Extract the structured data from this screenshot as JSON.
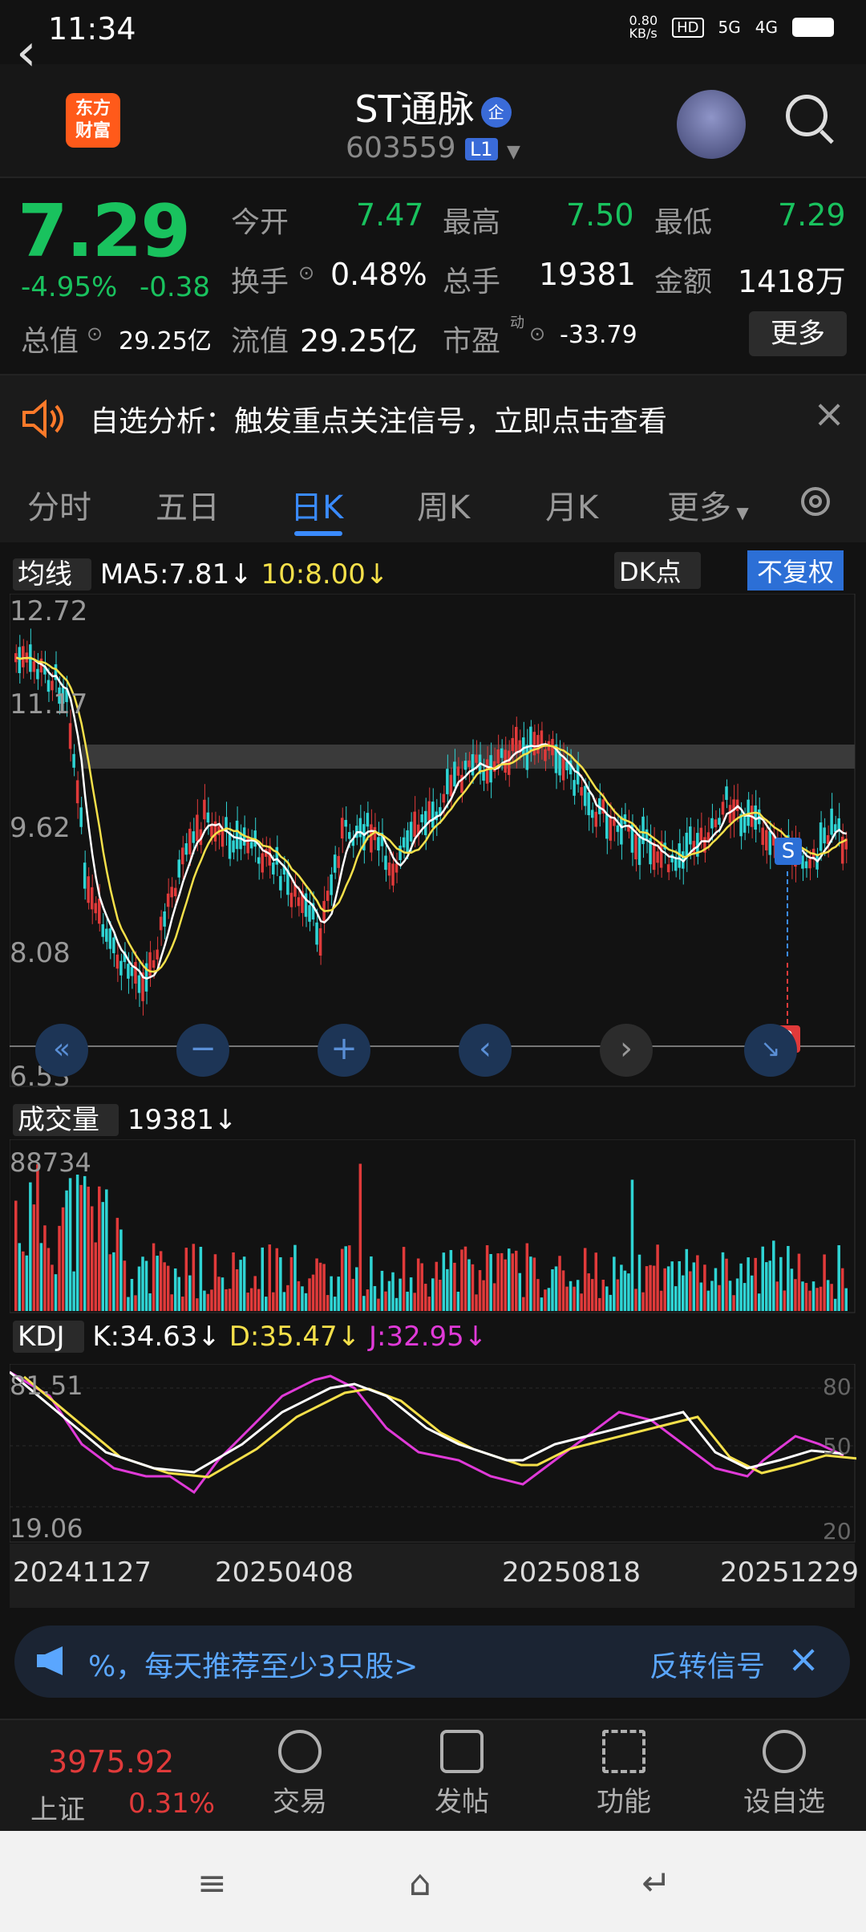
{
  "status": {
    "time": "11:34",
    "speed": "0.80\nKB/s",
    "net1": "5G",
    "net2": "4G"
  },
  "header": {
    "logo": "东方\n财富",
    "title": "ST通脉",
    "title_tag": "企",
    "code": "603559",
    "level": "L1"
  },
  "quote": {
    "price": "7.29",
    "pct": "-4.95%",
    "change": "-0.38",
    "open_label": "今开",
    "open": "7.47",
    "high_label": "最高",
    "high": "7.50",
    "low_label": "最低",
    "low": "7.29",
    "turnover_label": "换手",
    "turnover": "0.48%",
    "volume_label": "总手",
    "volume": "19381",
    "amount_label": "金额",
    "amount": "1418万",
    "mcap_label": "总值",
    "mcap": "29.25亿",
    "float_label": "流值",
    "float": "29.25亿",
    "pe_label": "市盈",
    "pe_sup": "动",
    "pe": "-33.79",
    "more": "更多"
  },
  "notice": {
    "text": "自选分析：触发重点关注信号，立即点击查看"
  },
  "tabs": [
    "分时",
    "五日",
    "日K",
    "周K",
    "月K",
    "更多"
  ],
  "kline": {
    "indicator": "均线",
    "ma5": "MA5:7.81↓",
    "ma10": "10:8.00↓",
    "dk": "DK点",
    "fq": "不复权",
    "levels": [
      "12.72",
      "11.17",
      "9.62",
      "8.08",
      "6.53"
    ],
    "signal_s": "S",
    "signal_b": "B"
  },
  "volume": {
    "indicator": "成交量",
    "value": "19381↓",
    "max": "88734"
  },
  "kdj": {
    "indicator": "KDJ",
    "k": "K:34.63↓",
    "d": "D:35.47↓",
    "j": "J:32.95↓",
    "top": "81.51",
    "bottom": "19.06",
    "r80": "80",
    "r50": "50",
    "r20": "20"
  },
  "dates": [
    "20241127",
    "20250408",
    "20250818",
    "20251229"
  ],
  "promo": {
    "text": "%，每天推荐至少3只股>",
    "right": "反转信号"
  },
  "index": {
    "value": "3975.92",
    "name": "上证",
    "pct": "0.31%"
  },
  "bottom_nav": [
    "交易",
    "发帖",
    "功能",
    "设自选"
  ],
  "colors": {
    "up": "#e03a3a",
    "down": "#2fd4d4",
    "green": "#19c25e",
    "accent": "#3a8bff",
    "ma5": "#ffffff",
    "ma10": "#f5e04a",
    "j": "#e03ad8"
  }
}
